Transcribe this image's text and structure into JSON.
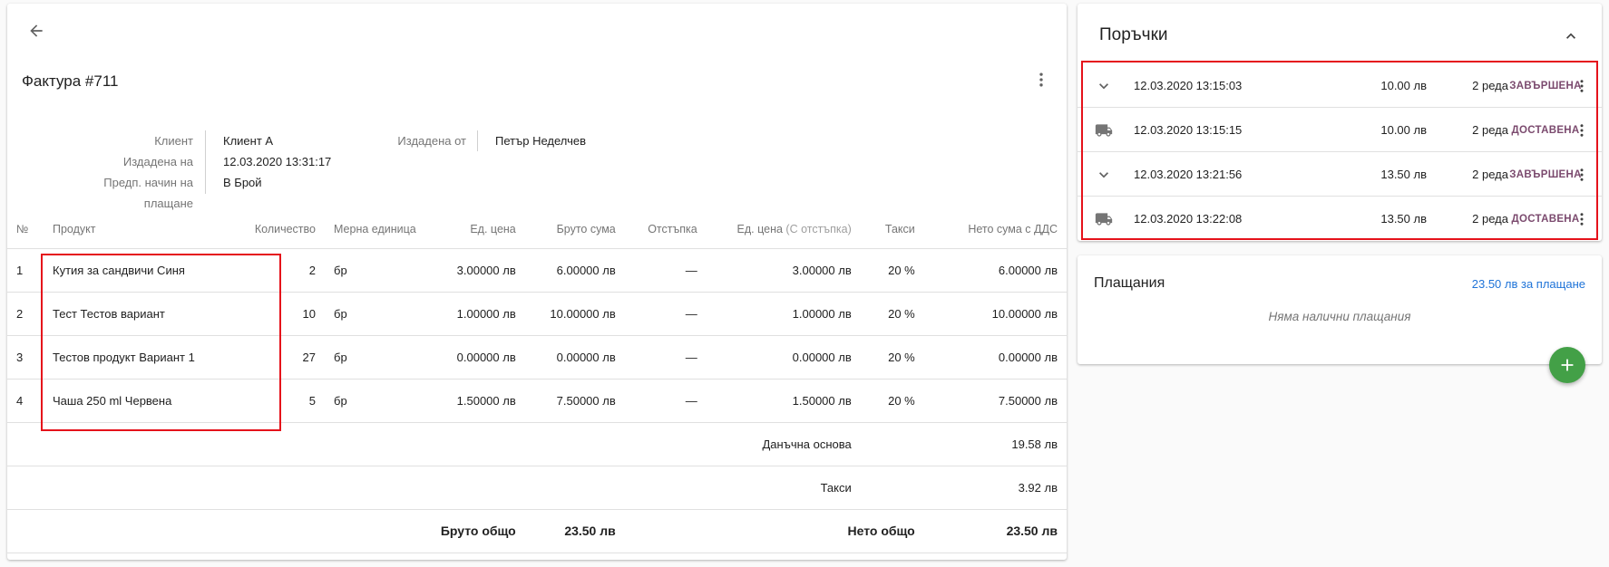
{
  "invoice": {
    "title": "Фактура #711",
    "info": {
      "client_label": "Клиент",
      "client_value": "Клиент А",
      "issued_on_label": "Издадена на",
      "issued_on_value": "12.03.2020 13:31:17",
      "payment_label": "Предп. начин на плащане",
      "payment_value": "В Брой",
      "issued_by_label": "Издадена от",
      "issued_by_value": "Петър Неделчев"
    },
    "columns": {
      "no": "№",
      "product": "Продукт",
      "quantity": "Количество",
      "unit": "Мерна единица",
      "unit_price": "Ед. цена",
      "gross": "Бруто сума",
      "discount": "Отстъпка",
      "unit_price_disc": "Ед. цена",
      "unit_price_disc_note": "(С отстъпка)",
      "taxes": "Такси",
      "net_vat": "Нето сума с ДДС"
    },
    "rows": [
      {
        "no": "1",
        "product": "Кутия за сандвичи Синя",
        "quantity": "2",
        "unit": "бр",
        "unit_price": "3.00000 лв",
        "gross": "6.00000 лв",
        "discount": "—",
        "unit_price_disc": "3.00000 лв",
        "taxes": "20 %",
        "net_vat": "6.00000 лв"
      },
      {
        "no": "2",
        "product": "Тест Тестов вариант",
        "quantity": "10",
        "unit": "бр",
        "unit_price": "1.00000 лв",
        "gross": "10.00000 лв",
        "discount": "—",
        "unit_price_disc": "1.00000 лв",
        "taxes": "20 %",
        "net_vat": "10.00000 лв"
      },
      {
        "no": "3",
        "product": "Тестов продукт Вариант 1",
        "quantity": "27",
        "unit": "бр",
        "unit_price": "0.00000 лв",
        "gross": "0.00000 лв",
        "discount": "—",
        "unit_price_disc": "0.00000 лв",
        "taxes": "20 %",
        "net_vat": "0.00000 лв"
      },
      {
        "no": "4",
        "product": "Чаша 250 ml Червена",
        "quantity": "5",
        "unit": "бр",
        "unit_price": "1.50000 лв",
        "gross": "7.50000 лв",
        "discount": "—",
        "unit_price_disc": "1.50000 лв",
        "taxes": "20 %",
        "net_vat": "7.50000 лв"
      }
    ],
    "summary": {
      "tax_base_label": "Данъчна основа",
      "tax_base_value": "19.58 лв",
      "taxes_label": "Такси",
      "taxes_value": "3.92 лв",
      "gross_total_label": "Бруто общо",
      "gross_total_value": "23.50 лв",
      "net_total_label": "Нето общо",
      "net_total_value": "23.50 лв"
    }
  },
  "orders": {
    "title": "Поръчки",
    "items": [
      {
        "icon": "chevron-down-icon",
        "date": "12.03.2020 13:15:03",
        "amount": "10.00 лв",
        "lines": "2 реда",
        "status": "ЗАВЪРШЕНА"
      },
      {
        "icon": "truck-icon",
        "date": "12.03.2020 13:15:15",
        "amount": "10.00 лв",
        "lines": "2 реда",
        "status": "ДОСТАВЕНА"
      },
      {
        "icon": "chevron-down-icon",
        "date": "12.03.2020 13:21:56",
        "amount": "13.50 лв",
        "lines": "2 реда",
        "status": "ЗАВЪРШЕНА"
      },
      {
        "icon": "truck-icon",
        "date": "12.03.2020 13:22:08",
        "amount": "13.50 лв",
        "lines": "2 реда",
        "status": "ДОСТАВЕНА"
      }
    ]
  },
  "payments": {
    "title": "Плащания",
    "due": "23.50 лв за плащане",
    "empty": "Няма налични плащания"
  },
  "colors": {
    "accent_blue": "#1e73d8",
    "status_purple": "#7b4a6e",
    "fab_green": "#43a047",
    "highlight_red": "#e5121b"
  }
}
